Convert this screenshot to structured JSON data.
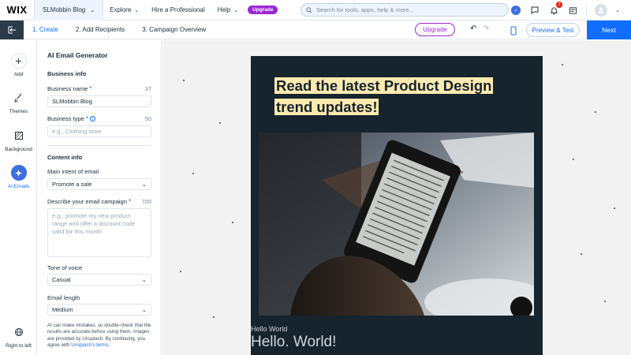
{
  "topbar": {
    "logo": "WIX",
    "site_name": "SLMobbin Blog",
    "nav": [
      "Explore",
      "Hire a Professional",
      "Help"
    ],
    "upgrade_label": "Upgrade",
    "search_placeholder": "Search for tools, apps, help & more...",
    "notification_count": "2",
    "help_badge": "✓"
  },
  "stepbar": {
    "steps": [
      "1. Create",
      "2. Add Recipients",
      "3. Campaign Overview"
    ],
    "upgrade_label": "Upgrade",
    "preview_label": "Preview & Test",
    "next_label": "Next"
  },
  "rail": {
    "items": [
      {
        "label": "Add",
        "icon": "plus-icon"
      },
      {
        "label": "Themes",
        "icon": "brush-icon"
      },
      {
        "label": "Background",
        "icon": "background-icon"
      },
      {
        "label": "AI Emails",
        "icon": "ai-sparkle-icon"
      }
    ],
    "bottom_label": "Right to left"
  },
  "panel": {
    "title": "AI Email Generator",
    "business_info": "Business info",
    "business_name_label": "Business name",
    "business_name_count": "37",
    "business_name_value": "SLMobbin Blog",
    "business_type_label": "Business type",
    "business_type_count": "50",
    "business_type_placeholder": "e.g., Clothing store",
    "content_info": "Content info",
    "intent_label": "Main intent of email",
    "intent_value": "Promote a sale",
    "describe_label": "Describe your email campaign",
    "describe_count": "700",
    "describe_placeholder": "e.g., promote my new product range and offer a discount code valid for this month",
    "tone_label": "Tone of voice",
    "tone_value": "Casual",
    "length_label": "Email length",
    "length_value": "Medium",
    "disclaimer_text": "AI can make mistakes, so double-check that the results are accurate before using them. Images are provided by Unsplash. By continuing, you agree with ",
    "disclaimer_link": "Unsplash's terms",
    "disclaimer_end": "."
  },
  "email": {
    "headline": "Read the latest Product Design trend updates!",
    "hello_small": "Hello World",
    "hello_big": "Hello. World!"
  },
  "colors": {
    "accent": "#116dff",
    "upgrade_purple": "#9a27d5",
    "email_bg": "#17232d",
    "highlight": "#fbeab0"
  }
}
